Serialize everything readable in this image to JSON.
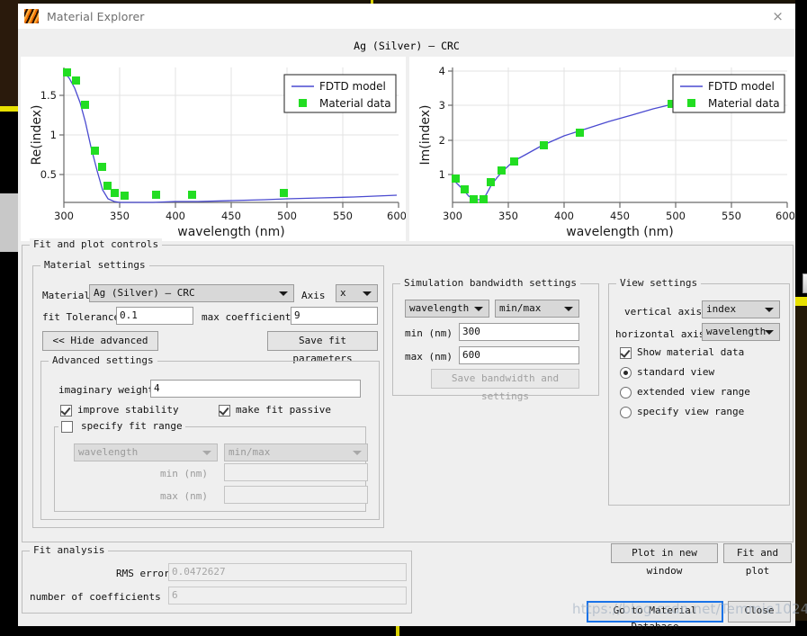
{
  "window": {
    "title": "Material Explorer",
    "close_label": "×",
    "app_icon": "material-explorer-icon"
  },
  "chart_title": "Ag (Silver) – CRC",
  "watermark": "https://blog.csdn.net/Temmie1024",
  "chart_data": [
    {
      "type": "line",
      "title": "Ag (Silver) – CRC",
      "xlabel": "wavelength (nm)",
      "ylabel": "Re(index)",
      "xlim": [
        300,
        600
      ],
      "ylim": [
        0.15,
        1.82
      ],
      "xticks": [
        300,
        350,
        400,
        450,
        500,
        550,
        600
      ],
      "yticks": [
        0.5,
        1,
        1.5
      ],
      "grid": true,
      "legend": [
        "FDTD model",
        "Material data"
      ],
      "legend_position": "upper right",
      "series": [
        {
          "name": "FDTD model",
          "kind": "line",
          "color": "#4a4ad0",
          "x": [
            300,
            305,
            310,
            315,
            320,
            325,
            330,
            335,
            340,
            345,
            350,
            360,
            380,
            400,
            420,
            450,
            480,
            500,
            530,
            560,
            600
          ],
          "y": [
            1.78,
            1.7,
            1.58,
            1.4,
            1.15,
            0.85,
            0.56,
            0.33,
            0.22,
            0.185,
            0.175,
            0.172,
            0.175,
            0.178,
            0.182,
            0.19,
            0.198,
            0.203,
            0.213,
            0.223,
            0.24
          ]
        },
        {
          "name": "Material data",
          "kind": "scatter",
          "color": "#22dd22",
          "x": [
            301,
            310,
            318,
            327,
            333,
            338,
            345,
            354,
            382,
            414,
            496
          ],
          "y": [
            1.77,
            1.62,
            1.31,
            0.73,
            0.53,
            0.29,
            0.205,
            0.19,
            0.195,
            0.195,
            0.2
          ]
        }
      ]
    },
    {
      "type": "line",
      "title": "Ag (Silver) – CRC",
      "xlabel": "wavelength (nm)",
      "ylabel": "Im(index)",
      "xlim": [
        300,
        600
      ],
      "ylim": [
        0.2,
        4.1
      ],
      "xticks": [
        300,
        350,
        400,
        450,
        500,
        550,
        600
      ],
      "yticks": [
        1,
        2,
        3,
        4
      ],
      "grid": true,
      "legend": [
        "FDTD model",
        "Material data"
      ],
      "legend_position": "upper right",
      "series": [
        {
          "name": "FDTD model",
          "kind": "line",
          "color": "#4a4ad0",
          "x": [
            300,
            305,
            310,
            315,
            320,
            325,
            330,
            335,
            340,
            345,
            355,
            365,
            380,
            400,
            420,
            440,
            460,
            480,
            500,
            510
          ],
          "y": [
            0.88,
            0.72,
            0.56,
            0.38,
            0.28,
            0.28,
            0.4,
            0.72,
            0.93,
            1.14,
            1.42,
            1.62,
            1.88,
            2.17,
            2.38,
            2.58,
            2.77,
            2.96,
            3.12,
            3.2
          ]
        },
        {
          "name": "Material data",
          "kind": "scatter",
          "color": "#22dd22",
          "x": [
            301,
            310,
            318,
            327,
            334,
            344,
            355,
            381,
            414,
            496
          ],
          "y": [
            0.88,
            0.59,
            0.29,
            0.28,
            0.78,
            1.14,
            1.43,
            1.88,
            2.27,
            3.1
          ]
        }
      ]
    }
  ],
  "fit_and_plot_controls": {
    "legend": "Fit and plot controls",
    "material_settings": {
      "legend": "Material settings",
      "material_label": "Material",
      "material_value": "Ag (Silver) – CRC",
      "axis_label": "Axis",
      "axis_value": "x",
      "fit_tolerance_label": "fit Tolerance",
      "fit_tolerance_value": "0.1",
      "max_coefficients_label": "max coefficients",
      "max_coefficients_value": "9",
      "hide_advanced_label": "<< Hide advanced",
      "save_fit_parameters_label": "Save fit parameters",
      "advanced": {
        "legend": "Advanced settings",
        "imaginary_weight_label": "imaginary weight",
        "imaginary_weight_value": "4",
        "improve_stability_label": "improve stability",
        "improve_stability_checked": true,
        "make_fit_passive_label": "make fit passive",
        "make_fit_passive_checked": true,
        "specify_fit_range_label": "specify fit range",
        "specify_fit_range_checked": false,
        "range_quantity_value": "wavelength",
        "range_mode_value": "min/max",
        "min_label": "min (nm)",
        "min_value": "",
        "max_label": "max (nm)",
        "max_value": ""
      }
    },
    "bandwidth_settings": {
      "legend": "Simulation bandwidth settings",
      "quantity_value": "wavelength",
      "mode_value": "min/max",
      "min_label": "min (nm)",
      "min_value": "300",
      "max_label": "max (nm)",
      "max_value": "600",
      "save_label": "Save bandwidth and settings"
    },
    "view_settings": {
      "legend": "View settings",
      "vertical_axis_label": "vertical axis",
      "vertical_axis_value": "index",
      "horizontal_axis_label": "horizontal axis",
      "horizontal_axis_value": "wavelength",
      "show_material_data_label": "Show material data",
      "show_material_data_checked": true,
      "view_mode_options": [
        "standard view",
        "extended view range",
        "specify view range"
      ],
      "view_mode_selected": "standard view"
    },
    "plot_in_new_window_label": "Plot in new window",
    "fit_and_plot_label": "Fit and plot"
  },
  "fit_analysis": {
    "legend": "Fit analysis",
    "rms_error_label": "RMS error",
    "rms_error_value": "0.0472627",
    "num_coefficients_label": "number of coefficients",
    "num_coefficients_value": "6"
  },
  "footer": {
    "go_to_material_database_label": "Go to Material Database",
    "close_label": "Close"
  }
}
